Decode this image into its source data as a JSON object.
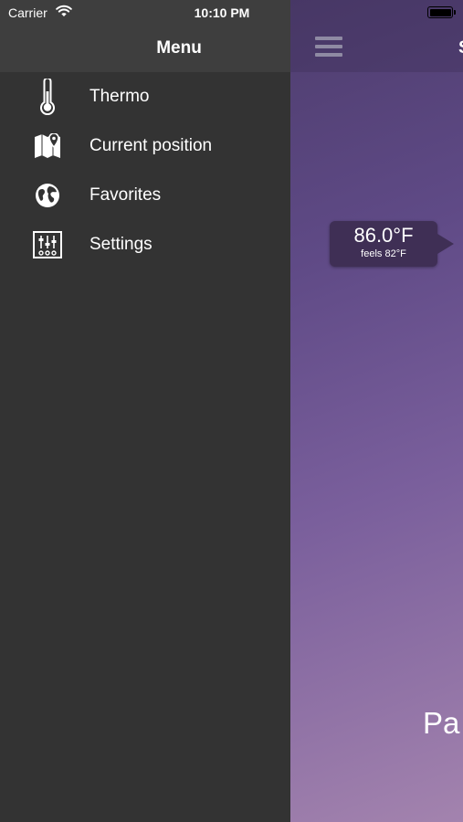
{
  "status_bar": {
    "carrier": "Carrier",
    "time": "10:10 PM"
  },
  "menu": {
    "title": "Menu",
    "items": [
      {
        "label": "Thermo",
        "icon": "thermometer-icon"
      },
      {
        "label": "Current position",
        "icon": "map-pin-icon"
      },
      {
        "label": "Favorites",
        "icon": "globe-icon"
      },
      {
        "label": "Settings",
        "icon": "sliders-icon"
      }
    ]
  },
  "content": {
    "title_partial": "S",
    "temperature": "86.0°F",
    "feels_like": "feels 82°F",
    "place_partial": "Pa"
  },
  "colors": {
    "drawer_bg": "#333333",
    "drawer_header": "#3e3e3e",
    "accent_purple": "#5f4a86",
    "bubble": "#3f2f55"
  }
}
